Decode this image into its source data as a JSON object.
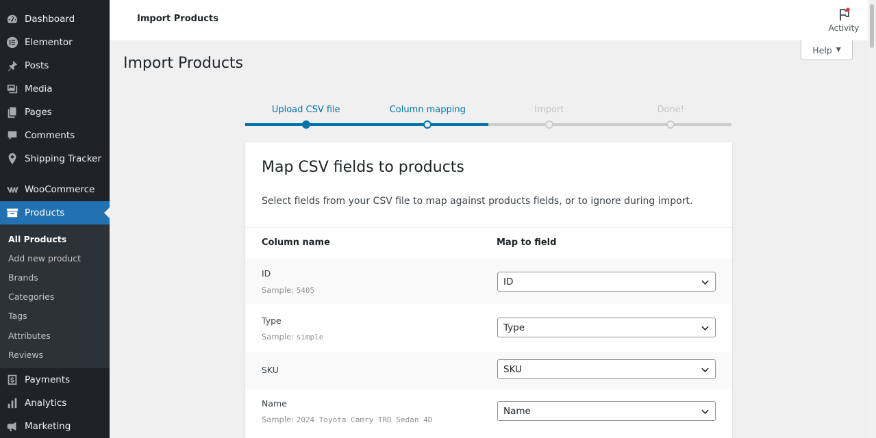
{
  "sidebar": {
    "items": [
      {
        "label": "Dashboard",
        "icon": "dashboard-icon"
      },
      {
        "label": "Elementor",
        "icon": "elementor-icon"
      },
      {
        "label": "Posts",
        "icon": "pushpin-icon"
      },
      {
        "label": "Media",
        "icon": "media-icon"
      },
      {
        "label": "Pages",
        "icon": "pages-icon"
      },
      {
        "label": "Comments",
        "icon": "comment-icon"
      },
      {
        "label": "Shipping Tracker",
        "icon": "location-pin-icon"
      },
      {
        "label": "WooCommerce",
        "icon": "woocommerce-icon"
      },
      {
        "label": "Products",
        "icon": "archive-box-icon"
      },
      {
        "label": "Payments",
        "icon": "dollar-icon"
      },
      {
        "label": "Analytics",
        "icon": "bar-chart-icon"
      },
      {
        "label": "Marketing",
        "icon": "megaphone-icon"
      }
    ],
    "submenu": [
      "All Products",
      "Add new product",
      "Brands",
      "Categories",
      "Tags",
      "Attributes",
      "Reviews"
    ]
  },
  "topbar": {
    "title": "Import Products",
    "activity_label": "Activity"
  },
  "help_label": "Help",
  "page_title": "Import Products",
  "steps": [
    {
      "label": "Upload CSV file",
      "state": "done"
    },
    {
      "label": "Column mapping",
      "state": "active"
    },
    {
      "label": "Import",
      "state": "pending"
    },
    {
      "label": "Done!",
      "state": "pending"
    }
  ],
  "card": {
    "title": "Map CSV fields to products",
    "description": "Select fields from your CSV file to map against products fields, or to ignore during import.",
    "column_name_header": "Column name",
    "map_to_field_header": "Map to field",
    "sample_prefix": "Sample:",
    "rows": [
      {
        "name": "ID",
        "sample": "5405",
        "field": "ID"
      },
      {
        "name": "Type",
        "sample": "simple",
        "field": "Type"
      },
      {
        "name": "SKU",
        "sample": "",
        "field": "SKU"
      },
      {
        "name": "Name",
        "sample": "2024 Toyota Camry TRD Sedan 4D",
        "field": "Name"
      }
    ]
  },
  "colors": {
    "sidebar_bg": "#1d2327",
    "active_blue": "#2271b1",
    "step_blue": "#0073aa",
    "notification_dot": "#d63638"
  }
}
